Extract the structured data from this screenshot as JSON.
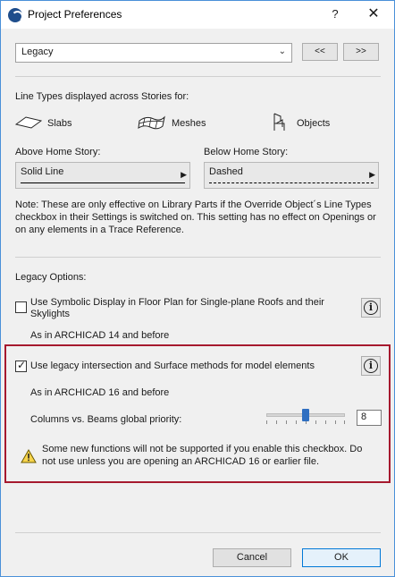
{
  "window": {
    "title": "Project Preferences",
    "help_label": "?",
    "close_label": "✕"
  },
  "preset": {
    "value": "Legacy",
    "prev_label": "<<",
    "next_label": ">>"
  },
  "line_types": {
    "heading": "Line Types displayed across Stories for:",
    "items": [
      {
        "label": "Slabs",
        "icon": "slab-icon"
      },
      {
        "label": "Meshes",
        "icon": "mesh-icon"
      },
      {
        "label": "Objects",
        "icon": "chair-icon"
      }
    ],
    "above": {
      "label": "Above Home Story:",
      "value": "Solid Line"
    },
    "below": {
      "label": "Below Home Story:",
      "value": "Dashed"
    },
    "note": "Note: These are only effective on Library Parts if the Override Object´s Line Types checkbox in their Settings is switched on. This setting has no effect on Openings or on any elements in a Trace Reference."
  },
  "legacy": {
    "heading": "Legacy Options:",
    "symbolic": {
      "label": "Use Symbolic Display in Floor Plan for Single-plane Roofs and their Skylights",
      "checked": false,
      "subtext": "As in ARCHICAD 14 and before"
    },
    "intersection": {
      "label": "Use legacy intersection and Surface methods for model elements",
      "checked": true,
      "subtext": "As in ARCHICAD 16 and before",
      "priority_label": "Columns vs. Beams global priority:",
      "priority_value": "8",
      "slider_fraction": 0.5,
      "warning": "Some new functions will not be supported if you enable this checkbox. Do not use unless you are opening an ARCHICAD 16 or earlier file."
    }
  },
  "buttons": {
    "cancel": "Cancel",
    "ok": "OK"
  },
  "colors": {
    "highlight": "#a6192e",
    "accent": "#0078d7",
    "thumb": "#2f6fc1"
  }
}
